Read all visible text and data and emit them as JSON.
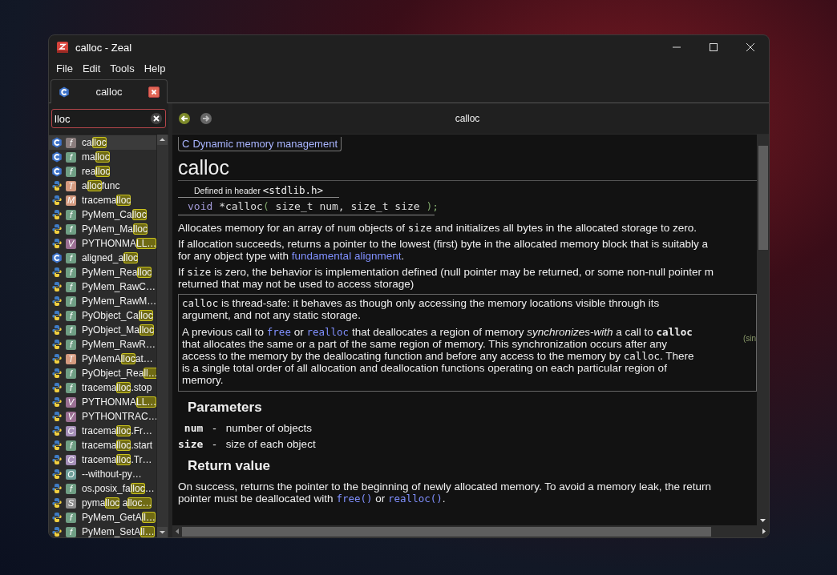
{
  "window": {
    "title": "calloc - Zeal"
  },
  "menu": [
    "File",
    "Edit",
    "Tools",
    "Help"
  ],
  "tabs": [
    {
      "label": "calloc",
      "kind": "c",
      "selected": true
    }
  ],
  "search": {
    "value": "lloc"
  },
  "results": [
    {
      "kind": "c",
      "badge": "f",
      "color": "#8a7d7d",
      "selected": true,
      "segments": [
        {
          "text": "ca",
          "match": false
        },
        {
          "text": "lloc",
          "match": true
        }
      ]
    },
    {
      "kind": "c",
      "badge": "f",
      "color": "#6f9e84",
      "selected": false,
      "segments": [
        {
          "text": "ma",
          "match": false
        },
        {
          "text": "lloc",
          "match": true
        }
      ]
    },
    {
      "kind": "c",
      "badge": "f",
      "color": "#6f9e84",
      "selected": false,
      "segments": [
        {
          "text": "rea",
          "match": false
        },
        {
          "text": "lloc",
          "match": true
        }
      ]
    },
    {
      "kind": "python",
      "badge": "T",
      "color": "#d49a7f",
      "selected": false,
      "segments": [
        {
          "text": "a",
          "match": false
        },
        {
          "text": "lloc",
          "match": true
        },
        {
          "text": "func",
          "match": false
        }
      ]
    },
    {
      "kind": "python",
      "badge": "M",
      "color": "#d49a7f",
      "selected": false,
      "segments": [
        {
          "text": "tracema",
          "match": false
        },
        {
          "text": "lloc",
          "match": true
        }
      ]
    },
    {
      "kind": "python",
      "badge": "f",
      "color": "#6f9e84",
      "selected": false,
      "segments": [
        {
          "text": "PyMem_Ca",
          "match": false
        },
        {
          "text": "lloc",
          "match": true
        }
      ]
    },
    {
      "kind": "python",
      "badge": "f",
      "color": "#6f9e84",
      "selected": false,
      "segments": [
        {
          "text": "PyMem_Ma",
          "match": false
        },
        {
          "text": "lloc",
          "match": true
        }
      ]
    },
    {
      "kind": "python",
      "badge": "V",
      "color": "#9a6f93",
      "selected": false,
      "segments": [
        {
          "text": "PYTHONMA",
          "match": false
        },
        {
          "text": "LL…",
          "match": true
        }
      ]
    },
    {
      "kind": "c",
      "badge": "f",
      "color": "#6f9e84",
      "selected": false,
      "segments": [
        {
          "text": "aligned_a",
          "match": false
        },
        {
          "text": "lloc",
          "match": true
        }
      ]
    },
    {
      "kind": "python",
      "badge": "f",
      "color": "#6f9e84",
      "selected": false,
      "segments": [
        {
          "text": "PyMem_Rea",
          "match": false
        },
        {
          "text": "lloc",
          "match": true
        }
      ]
    },
    {
      "kind": "python",
      "badge": "f",
      "color": "#6f9e84",
      "selected": false,
      "segments": [
        {
          "text": "PyMem_RawC…",
          "match": false
        }
      ]
    },
    {
      "kind": "python",
      "badge": "f",
      "color": "#6f9e84",
      "selected": false,
      "segments": [
        {
          "text": "PyMem_RawM…",
          "match": false
        }
      ]
    },
    {
      "kind": "python",
      "badge": "f",
      "color": "#6f9e84",
      "selected": false,
      "segments": [
        {
          "text": "PyObject_Ca",
          "match": false
        },
        {
          "text": "lloc",
          "match": true
        }
      ]
    },
    {
      "kind": "python",
      "badge": "f",
      "color": "#6f9e84",
      "selected": false,
      "segments": [
        {
          "text": "PyObject_Ma",
          "match": false
        },
        {
          "text": "lloc",
          "match": true
        }
      ]
    },
    {
      "kind": "python",
      "badge": "f",
      "color": "#6f9e84",
      "selected": false,
      "segments": [
        {
          "text": "PyMem_RawR…",
          "match": false
        }
      ]
    },
    {
      "kind": "python",
      "badge": "T",
      "color": "#d49a7f",
      "selected": false,
      "segments": [
        {
          "text": "PyMemA",
          "match": false
        },
        {
          "text": "lloc",
          "match": true
        },
        {
          "text": "at…",
          "match": false
        }
      ]
    },
    {
      "kind": "python",
      "badge": "f",
      "color": "#6f9e84",
      "selected": false,
      "segments": [
        {
          "text": "PyObject_Rea",
          "match": false
        },
        {
          "text": "ll…",
          "match": true
        }
      ]
    },
    {
      "kind": "python",
      "badge": "f",
      "color": "#6f9e84",
      "selected": false,
      "segments": [
        {
          "text": "tracema",
          "match": false
        },
        {
          "text": "lloc",
          "match": true
        },
        {
          "text": ".stop",
          "match": false
        }
      ]
    },
    {
      "kind": "python",
      "badge": "V",
      "color": "#9a6f93",
      "selected": false,
      "segments": [
        {
          "text": "PYTHONMA",
          "match": false
        },
        {
          "text": "LL…",
          "match": true
        }
      ]
    },
    {
      "kind": "python",
      "badge": "V",
      "color": "#9a6f93",
      "selected": false,
      "segments": [
        {
          "text": "PYTHONTRAC…",
          "match": false
        }
      ]
    },
    {
      "kind": "python",
      "badge": "C",
      "color": "#a58fb8",
      "selected": false,
      "segments": [
        {
          "text": "tracema",
          "match": false
        },
        {
          "text": "lloc",
          "match": true
        },
        {
          "text": ".Fr…",
          "match": false
        }
      ]
    },
    {
      "kind": "python",
      "badge": "f",
      "color": "#6f9e84",
      "selected": false,
      "segments": [
        {
          "text": "tracema",
          "match": false
        },
        {
          "text": "lloc",
          "match": true
        },
        {
          "text": ".start",
          "match": false
        }
      ]
    },
    {
      "kind": "python",
      "badge": "C",
      "color": "#a58fb8",
      "selected": false,
      "segments": [
        {
          "text": "tracema",
          "match": false
        },
        {
          "text": "lloc",
          "match": true
        },
        {
          "text": ".Tr…",
          "match": false
        }
      ]
    },
    {
      "kind": "python",
      "badge": "O",
      "color": "#6f9e9a",
      "selected": false,
      "segments": [
        {
          "text": "--without-py…",
          "match": false
        }
      ]
    },
    {
      "kind": "python",
      "badge": "f",
      "color": "#6f9e84",
      "selected": false,
      "segments": [
        {
          "text": "os.posix_fa",
          "match": false
        },
        {
          "text": "lloc",
          "match": true
        },
        {
          "text": "…",
          "match": false
        }
      ]
    },
    {
      "kind": "python",
      "badge": "S",
      "color": "#8d8d8d",
      "selected": false,
      "segments": [
        {
          "text": "pyma",
          "match": false
        },
        {
          "text": "lloc",
          "match": true
        },
        {
          "text": " a",
          "match": false
        },
        {
          "text": "lloc…",
          "match": true
        }
      ]
    },
    {
      "kind": "python",
      "badge": "f",
      "color": "#6f9e84",
      "selected": false,
      "segments": [
        {
          "text": "PyMem_GetA",
          "match": false
        },
        {
          "text": "ll…",
          "match": true
        }
      ]
    },
    {
      "kind": "python",
      "badge": "f",
      "color": "#6f9e84",
      "selected": false,
      "segments": [
        {
          "text": "PyMem_SetA",
          "match": false
        },
        {
          "text": "ll…",
          "match": true
        }
      ]
    }
  ],
  "page": {
    "title": "calloc",
    "breadcrumb": [
      "C",
      "Dynamic memory management"
    ],
    "heading": "calloc",
    "declaration": {
      "header": [
        {
          "text": "Defined in header ",
          "kind": "text"
        },
        {
          "text": "<stdlib.h>",
          "kind": "code"
        }
      ],
      "signature": [
        {
          "text": "void",
          "kind": "keyword"
        },
        {
          "text": " *calloc",
          "kind": "plain"
        },
        {
          "text": "(",
          "kind": "punct"
        },
        {
          "text": " size_t num, size_t size ",
          "kind": "plain"
        },
        {
          "text": ");",
          "kind": "punct"
        }
      ]
    },
    "paragraphs": [
      {
        "lines": [
          [
            {
              "text": "Allocates memory for an array of ",
              "kind": "text"
            },
            {
              "text": "num",
              "kind": "code"
            },
            {
              "text": " objects of ",
              "kind": "text"
            },
            {
              "text": "size",
              "kind": "code"
            },
            {
              "text": " and initializes all bytes in the allocated storage to zero.",
              "kind": "text"
            }
          ]
        ]
      },
      {
        "lines": [
          [
            {
              "text": "If allocation succeeds, returns a pointer to the lowest (first) byte in the allocated memory block that is suitably a",
              "kind": "text"
            }
          ],
          [
            {
              "text": "for any object type with ",
              "kind": "text"
            },
            {
              "text": "fundamental alignment",
              "kind": "link"
            },
            {
              "text": ".",
              "kind": "text"
            }
          ]
        ]
      },
      {
        "lines": [
          [
            {
              "text": "If ",
              "kind": "text"
            },
            {
              "text": "size",
              "kind": "code"
            },
            {
              "text": " is zero, the behavior is implementation defined (null pointer may be returned, or some non-null pointer m",
              "kind": "text"
            }
          ],
          [
            {
              "text": "returned that may not be used to access storage)",
              "kind": "text"
            }
          ]
        ]
      }
    ],
    "note": {
      "paragraphs": [
        {
          "lines": [
            [
              {
                "text": "calloc",
                "kind": "code"
              },
              {
                "text": " is thread-safe: it behaves as though only accessing the memory locations visible through its",
                "kind": "text"
              }
            ],
            [
              {
                "text": "argument, and not any static storage.",
                "kind": "text"
              }
            ]
          ]
        },
        {
          "lines": [
            [
              {
                "text": "A previous call to ",
                "kind": "text"
              },
              {
                "text": "free",
                "kind": "code-link"
              },
              {
                "text": " or ",
                "kind": "text"
              },
              {
                "text": "realloc",
                "kind": "code-link"
              },
              {
                "text": " that deallocates a region of memory ",
                "kind": "text"
              },
              {
                "text": "synchronizes-with",
                "kind": "em"
              },
              {
                "text": " a call to ",
                "kind": "text"
              },
              {
                "text": "calloc",
                "kind": "strong-code"
              }
            ],
            [
              {
                "text": "that allocates the same or a part of the same region of memory. This synchronization occurs after any",
                "kind": "text"
              }
            ],
            [
              {
                "text": "access to the memory by the deallocating function and before any access to the memory by ",
                "kind": "text"
              },
              {
                "text": "calloc",
                "kind": "code"
              },
              {
                "text": ". There",
                "kind": "text"
              }
            ],
            [
              {
                "text": "is a single total order of all allocation and deallocation functions operating on each particular region of",
                "kind": "text"
              }
            ],
            [
              {
                "text": "memory.",
                "kind": "text"
              }
            ]
          ]
        }
      ],
      "side": "(sin"
    },
    "parameters": {
      "heading": "Parameters",
      "rows": [
        {
          "name": "num",
          "dash": "-",
          "desc": "number of objects"
        },
        {
          "name": "size",
          "dash": "-",
          "desc": "size of each object"
        }
      ]
    },
    "return_value": {
      "heading": "Return value",
      "paragraph": {
        "lines": [
          [
            {
              "text": "On success, returns the pointer to the beginning of newly allocated memory. To avoid a memory leak, the return",
              "kind": "text"
            }
          ],
          [
            {
              "text": "pointer must be deallocated with ",
              "kind": "text"
            },
            {
              "text": "free()",
              "kind": "code-link"
            },
            {
              "text": " or ",
              "kind": "text"
            },
            {
              "text": "realloc()",
              "kind": "code-link"
            },
            {
              "text": ".",
              "kind": "text"
            }
          ]
        ]
      }
    }
  }
}
